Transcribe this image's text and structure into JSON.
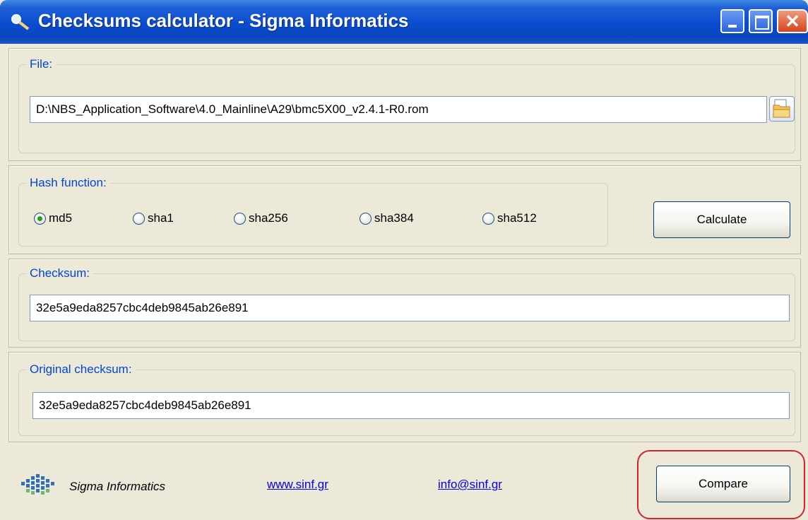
{
  "window": {
    "title": "Checksums calculator - Sigma Informatics",
    "close_glyph": "✕"
  },
  "file": {
    "legend": "File:",
    "path": "D:\\NBS_Application_Software\\4.0_Mainline\\A29\\bmc5X00_v2.4.1-R0.rom"
  },
  "hash": {
    "legend": "Hash function:",
    "options": [
      {
        "label": "md5",
        "selected": true
      },
      {
        "label": "sha1",
        "selected": false
      },
      {
        "label": "sha256",
        "selected": false
      },
      {
        "label": "sha384",
        "selected": false
      },
      {
        "label": "sha512",
        "selected": false
      }
    ],
    "calculate_label": "Calculate"
  },
  "checksum": {
    "legend": "Checksum:",
    "value": "32e5a9eda8257cbc4deb9845ab26e891"
  },
  "original_checksum": {
    "legend": "Original checksum:",
    "value": "32e5a9eda8257cbc4deb9845ab26e891"
  },
  "footer": {
    "brand": "Sigma Informatics",
    "website": "www.sinf.gr",
    "email": "info@sinf.gr",
    "compare_label": "Compare"
  },
  "icons": {
    "app": "magnifier-icon",
    "browse": "folder-icon",
    "logo": "sigma-logo-icon"
  },
  "colors": {
    "titlebar": "#0a4ccf",
    "legend_text": "#0046d5",
    "highlight": "#d6222a",
    "link": "#0000ee"
  }
}
